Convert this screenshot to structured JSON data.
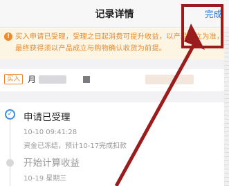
{
  "navbar": {
    "title": "记录详情",
    "done_label": "完成"
  },
  "notice": {
    "icon": "warning-icon",
    "text": "买入申请已受理，受理之日起消费可提升收益，以产品成立为准，最终获得须以产品成立与购物确认收货为前提。"
  },
  "product": {
    "tag": "买入",
    "name": "月"
  },
  "timeline": {
    "step1": {
      "title": "申请已受理",
      "time": "10-10 09:41:28",
      "desc": "资金已冻结，预计10-17完成扣款"
    },
    "step2": {
      "title": "开始计算收益",
      "time": "10-19 星期三"
    }
  },
  "colors": {
    "accent": "#1a73e8",
    "warning": "#e8892c",
    "annotation": "#9b1c1c"
  }
}
